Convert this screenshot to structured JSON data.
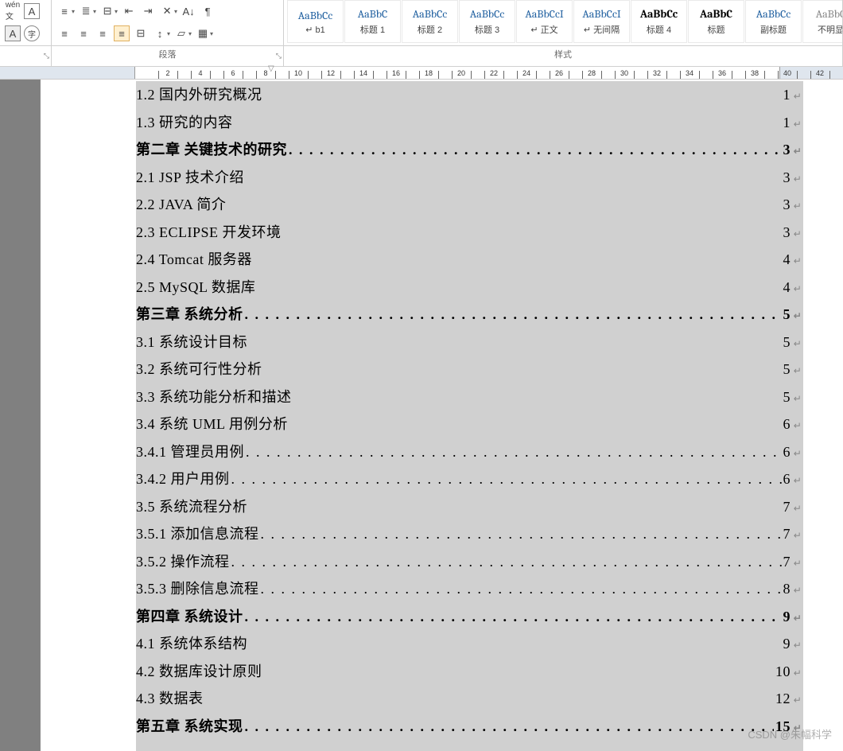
{
  "groupLabels": {
    "paragraph": "段落",
    "styles": "样式"
  },
  "styles": [
    {
      "preview": "AaBbCc",
      "label": "↵ b1",
      "cls": ""
    },
    {
      "preview": "AaBbC",
      "label": "标题 1",
      "cls": ""
    },
    {
      "preview": "AaBbCc",
      "label": "标题 2",
      "cls": ""
    },
    {
      "preview": "AaBbCc",
      "label": "标题 3",
      "cls": ""
    },
    {
      "preview": "AaBbCcI",
      "label": "↵ 正文",
      "cls": ""
    },
    {
      "preview": "AaBbCcI",
      "label": "↵ 无间隔",
      "cls": ""
    },
    {
      "preview": "AaBbCc",
      "label": "标题 4",
      "cls": "black-preview"
    },
    {
      "preview": "AaBbC",
      "label": "标题",
      "cls": "black-preview"
    },
    {
      "preview": "AaBbCc",
      "label": "副标题",
      "cls": ""
    },
    {
      "preview": "AaBbC",
      "label": "不明显",
      "cls": "gray-preview"
    }
  ],
  "rulerNums": [
    2,
    4,
    6,
    8,
    10,
    12,
    14,
    16,
    18,
    20,
    22,
    24,
    26,
    28,
    30,
    32,
    34,
    36,
    38,
    40,
    42
  ],
  "toc": [
    {
      "text": "1.2 国内外研究概况",
      "page": "1",
      "bold": false,
      "dots": false
    },
    {
      "text": "1.3 研究的内容",
      "page": "1",
      "bold": false,
      "dots": false
    },
    {
      "text": "第二章 关键技术的研究",
      "page": "3",
      "bold": true,
      "dots": true
    },
    {
      "text": "2.1 JSP 技术介绍",
      "page": "3",
      "bold": false,
      "dots": false
    },
    {
      "text": "2.2 JAVA 简介",
      "page": "3",
      "bold": false,
      "dots": false
    },
    {
      "text": "2.3 ECLIPSE 开发环境",
      "page": "3",
      "bold": false,
      "dots": false
    },
    {
      "text": "2.4 Tomcat 服务器",
      "page": "4",
      "bold": false,
      "dots": false
    },
    {
      "text": "2.5 MySQL 数据库",
      "page": "4",
      "bold": false,
      "dots": false
    },
    {
      "text": "第三章 系统分析",
      "page": "5",
      "bold": true,
      "dots": true
    },
    {
      "text": "3.1 系统设计目标",
      "page": "5",
      "bold": false,
      "dots": false
    },
    {
      "text": "3.2 系统可行性分析",
      "page": "5",
      "bold": false,
      "dots": false
    },
    {
      "text": "3.3 系统功能分析和描述",
      "page": "5",
      "bold": false,
      "dots": false
    },
    {
      "text": "3.4 系统 UML 用例分析",
      "page": "6",
      "bold": false,
      "dots": false
    },
    {
      "text": "3.4.1 管理员用例",
      "page": "6",
      "bold": false,
      "dots": true
    },
    {
      "text": "3.4.2 用户用例",
      "page": "6",
      "bold": false,
      "dots": true
    },
    {
      "text": "3.5 系统流程分析",
      "page": "7",
      "bold": false,
      "dots": false
    },
    {
      "text": "3.5.1 添加信息流程",
      "page": "7",
      "bold": false,
      "dots": true
    },
    {
      "text": "3.5.2 操作流程",
      "page": "7",
      "bold": false,
      "dots": true
    },
    {
      "text": "3.5.3 删除信息流程",
      "page": "8",
      "bold": false,
      "dots": true
    },
    {
      "text": "第四章 系统设计",
      "page": "9",
      "bold": true,
      "dots": true
    },
    {
      "text": "4.1 系统体系结构",
      "page": "9",
      "bold": false,
      "dots": false
    },
    {
      "text": "4.2 数据库设计原则",
      "page": "10",
      "bold": false,
      "dots": false
    },
    {
      "text": "4.3 数据表",
      "page": "12",
      "bold": false,
      "dots": false
    },
    {
      "text": "第五章 系统实现",
      "page": "15",
      "bold": true,
      "dots": true
    }
  ],
  "dotFill": ". . . . . . . . . . . . . . . . . . . . . . . . . . . . . . . . . . . . . . . . . . . . . . . . . . . . . . . . . . . . . . . . . . . . . . . . . . . . . . . . . . . . . . . . . . .",
  "returnChar": "↵",
  "watermark": "CSDN @朱幅科学"
}
